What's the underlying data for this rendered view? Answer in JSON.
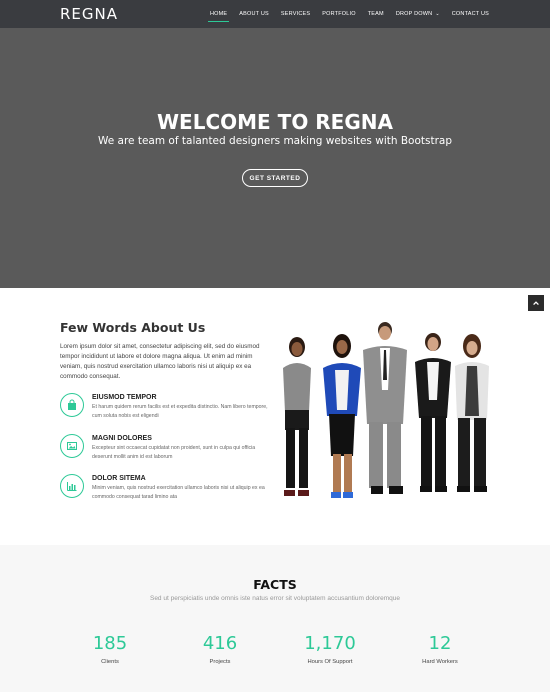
{
  "header": {
    "logo": "REGNA",
    "nav": [
      {
        "label": "HOME",
        "active": true
      },
      {
        "label": "ABOUT US",
        "active": false
      },
      {
        "label": "SERVICES",
        "active": false
      },
      {
        "label": "PORTFOLIO",
        "active": false
      },
      {
        "label": "TEAM",
        "active": false
      },
      {
        "label": "DROP DOWN",
        "active": false,
        "dropdown": true
      },
      {
        "label": "CONTACT US",
        "active": false
      }
    ]
  },
  "hero": {
    "title": "WELCOME TO REGNA",
    "subtitle": "We are team of talanted designers making websites with Bootstrap",
    "cta": "GET STARTED",
    "back_to_top_icon": "chevron-up-icon"
  },
  "about": {
    "title": "Few Words About Us",
    "text": "Lorem ipsum dolor sit amet, consectetur adipiscing elit, sed do eiusmod tempor incididunt ut labore et dolore magna aliqua. Ut enim ad minim veniam, quis nostrud exercitation ullamco laboris nisi ut aliquip ex ea commodo consequat.",
    "features": [
      {
        "icon": "shopping-bag-icon",
        "title": "EIUSMOD TEMPOR",
        "desc": "Et harum quidem rerum facilis est et expedita distinctio. Nam libero tempore, cum soluta nobis est eligendi"
      },
      {
        "icon": "image-icon",
        "title": "MAGNI DOLORES",
        "desc": "Excepteur sint occaecat cupidatat non proident, sunt in culpa qui officia deserunt mollit anim id est laborum"
      },
      {
        "icon": "bar-chart-icon",
        "title": "DOLOR SITEMA",
        "desc": "Minim veniam, quis nostrud exercitation ullamco laboris nisi ut aliquip ex ea commodo consequat tarad limino ata"
      }
    ]
  },
  "facts": {
    "title": "FACTS",
    "subtitle": "Sed ut perspiciatis unde omnis iste natus error sit voluptatem accusantium doloremque",
    "items": [
      {
        "number": "185",
        "label": "Clients"
      },
      {
        "number": "416",
        "label": "Projects"
      },
      {
        "number": "1,170",
        "label": "Hours Of Support"
      },
      {
        "number": "12",
        "label": "Hard Workers"
      }
    ]
  },
  "colors": {
    "accent": "#2dc997",
    "header_bg": "#3a3c40",
    "hero_bg": "#5a5a5a"
  }
}
